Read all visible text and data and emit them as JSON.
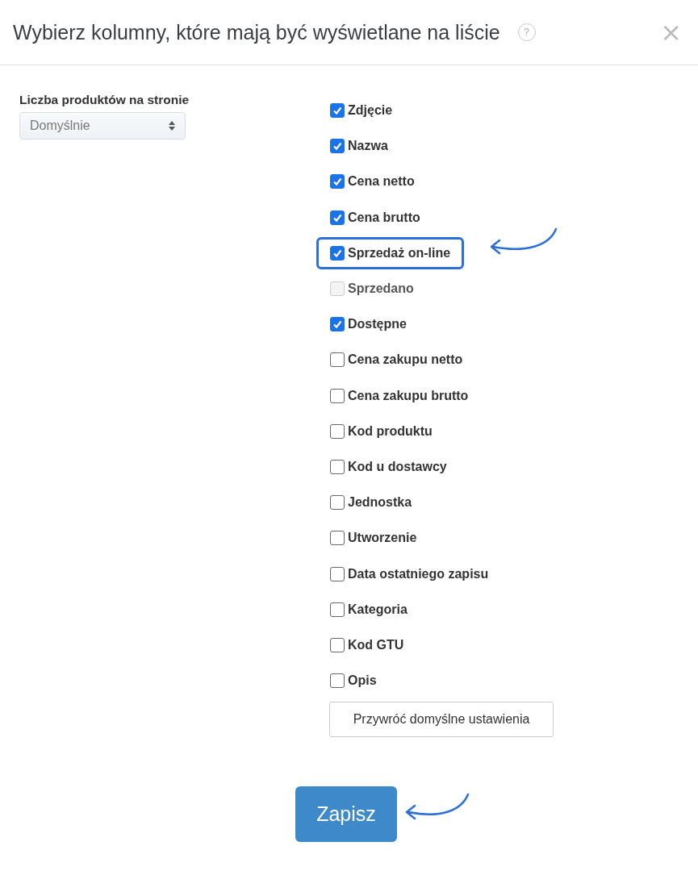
{
  "dialog": {
    "title": "Wybierz kolumny, które mają być wyświetlane na liście",
    "help_icon": "?",
    "close_icon": "×"
  },
  "page_size": {
    "label": "Liczba produktów na stronie",
    "value": "Domyślnie"
  },
  "columns": [
    {
      "label": "Zdjęcie",
      "checked": true,
      "disabled": false,
      "highlighted": false
    },
    {
      "label": "Nazwa",
      "checked": true,
      "disabled": false,
      "highlighted": false
    },
    {
      "label": "Cena netto",
      "checked": true,
      "disabled": false,
      "highlighted": false
    },
    {
      "label": "Cena brutto",
      "checked": true,
      "disabled": false,
      "highlighted": false
    },
    {
      "label": "Sprzedaż on-line",
      "checked": true,
      "disabled": false,
      "highlighted": true
    },
    {
      "label": "Sprzedano",
      "checked": false,
      "disabled": true,
      "highlighted": false
    },
    {
      "label": "Dostępne",
      "checked": true,
      "disabled": false,
      "highlighted": false
    },
    {
      "label": "Cena zakupu netto",
      "checked": false,
      "disabled": false,
      "highlighted": false
    },
    {
      "label": "Cena zakupu brutto",
      "checked": false,
      "disabled": false,
      "highlighted": false
    },
    {
      "label": "Kod produktu",
      "checked": false,
      "disabled": false,
      "highlighted": false
    },
    {
      "label": "Kod u dostawcy",
      "checked": false,
      "disabled": false,
      "highlighted": false
    },
    {
      "label": "Jednostka",
      "checked": false,
      "disabled": false,
      "highlighted": false
    },
    {
      "label": "Utworzenie",
      "checked": false,
      "disabled": false,
      "highlighted": false
    },
    {
      "label": "Data ostatniego zapisu",
      "checked": false,
      "disabled": false,
      "highlighted": false
    },
    {
      "label": "Kategoria",
      "checked": false,
      "disabled": false,
      "highlighted": false
    },
    {
      "label": "Kod GTU",
      "checked": false,
      "disabled": false,
      "highlighted": false
    },
    {
      "label": "Opis",
      "checked": false,
      "disabled": false,
      "highlighted": false
    }
  ],
  "restore_button": "Przywróć domyślne ustawienia",
  "save_button": "Zapisz"
}
